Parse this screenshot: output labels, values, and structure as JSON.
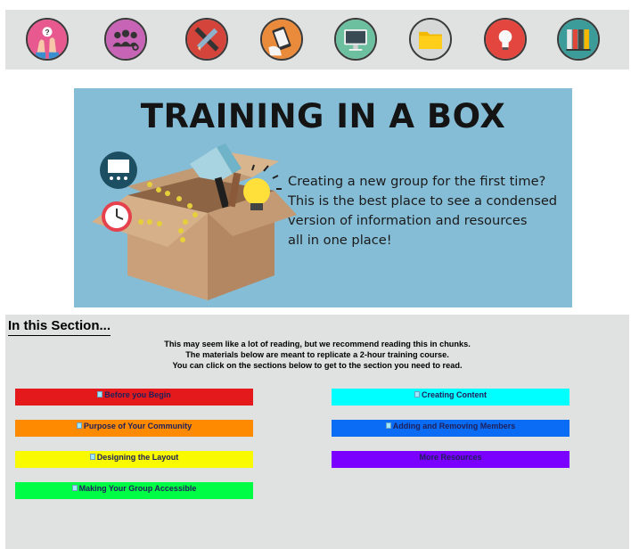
{
  "nav_icons": [
    {
      "name": "question-hands-icon",
      "bg": "#e85a8f"
    },
    {
      "name": "group-people-icon",
      "bg": "#c764b5"
    },
    {
      "name": "pencil-ruler-icon",
      "bg": "#d5443a"
    },
    {
      "name": "tablet-hand-icon",
      "bg": "#e98b3a"
    },
    {
      "name": "monitor-icon",
      "bg": "#6cc0a0"
    },
    {
      "name": "folder-icon",
      "bg": "#d6d8d8"
    },
    {
      "name": "lightbulb-icon",
      "bg": "#e3463f"
    },
    {
      "name": "binders-icon",
      "bg": "#3c9c9a"
    }
  ],
  "banner": {
    "title": "TRAINING IN A BOX",
    "lines": [
      "Creating a new group for the first time?",
      "This is the best place to see a condensed",
      "version of information and resources",
      "all in one place!"
    ]
  },
  "section": {
    "title": "In this Section...",
    "intro": [
      "This may seem like a lot of reading, but we recommend reading this in chunks.",
      "The materials below are meant to replicate a 2-hour training course.",
      "You can click on the sections below to get to the section you need to read."
    ],
    "links": [
      {
        "label": "Before you Begin",
        "color": "#e3191b",
        "icon": true
      },
      {
        "label": "Creating Content",
        "color": "#00ffff",
        "icon": true
      },
      {
        "label": "Purpose of Your Community",
        "color": "#fd8a00",
        "icon": true
      },
      {
        "label": "Adding and Removing Members",
        "color": "#0a6cf5",
        "icon": true
      },
      {
        "label": "Designing the Layout",
        "color": "#f9f900",
        "icon": true
      },
      {
        "label": "More Resources",
        "color": "#7a00ff",
        "icon": false
      },
      {
        "label": "Making Your Group Accessible",
        "color": "#00fd45",
        "icon": true
      }
    ]
  }
}
